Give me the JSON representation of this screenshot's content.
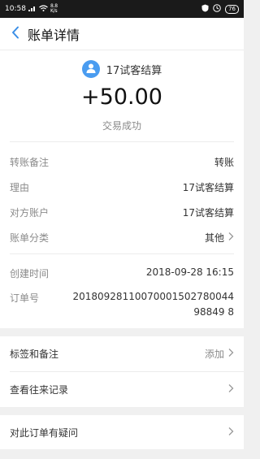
{
  "status_bar": {
    "time": "10:58",
    "network": "4G",
    "speed_line1": "8.8",
    "speed_line2": "K/s",
    "battery": "76"
  },
  "nav": {
    "title": "账单详情"
  },
  "summary": {
    "payee_name": "17试客结算",
    "amount": "+50.00",
    "status": "交易成功"
  },
  "details": [
    {
      "label": "转账备注",
      "value": "转账"
    },
    {
      "label": "理由",
      "value": "17试客结算"
    },
    {
      "label": "对方账户",
      "value": "17试客结算"
    },
    {
      "label": "账单分类",
      "value": "其他"
    }
  ],
  "meta": {
    "created_label": "创建时间",
    "created_value": "2018-09-28 16:15",
    "order_label": "订单号",
    "order_value": "2018092811007000150278004498849 8"
  },
  "actions": {
    "tags_label": "标签和备注",
    "tags_action": "添加",
    "history_label": "查看往来记录",
    "question_label": "对此订单有疑问"
  },
  "colors": {
    "accent": "#4a9cf0",
    "back_arrow": "#3a8ee6"
  }
}
